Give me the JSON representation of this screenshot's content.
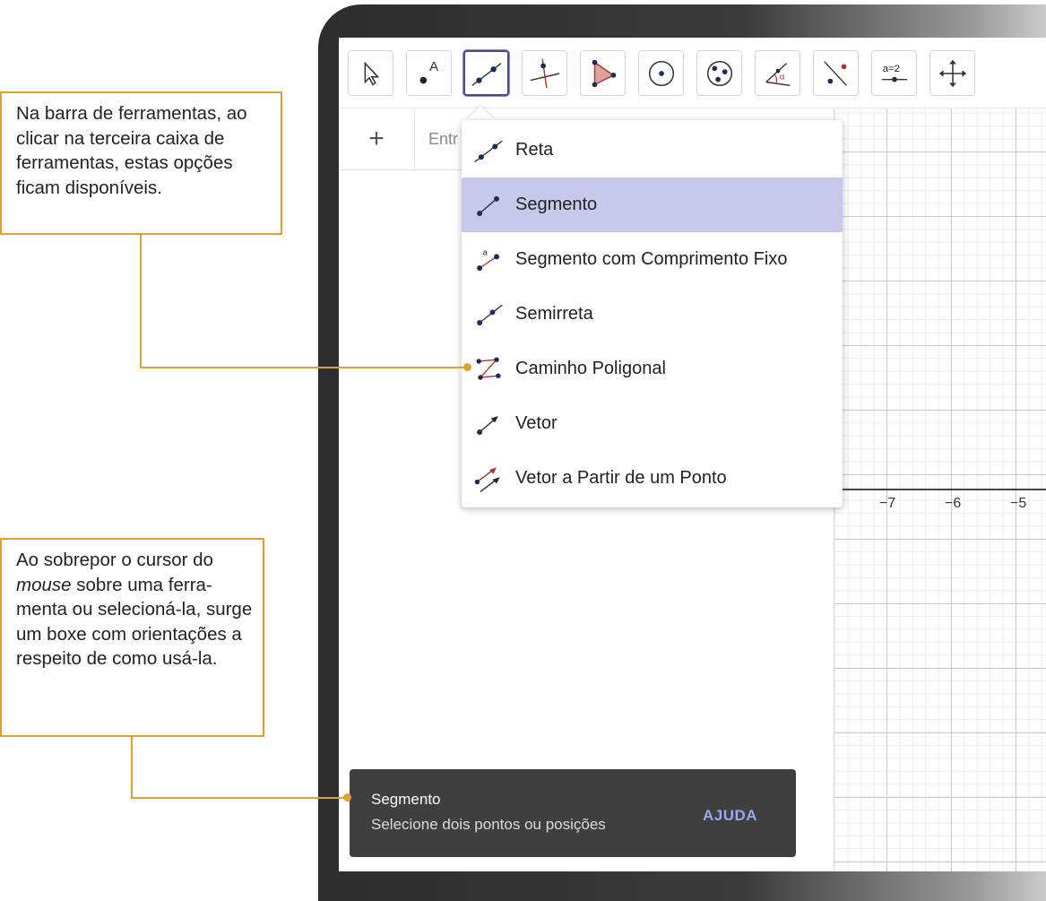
{
  "toolbar": {
    "tools": [
      {
        "name": "move-tool-icon"
      },
      {
        "name": "point-tool-icon"
      },
      {
        "name": "line-tool-icon"
      },
      {
        "name": "perpendicular-tool-icon"
      },
      {
        "name": "polygon-tool-icon"
      },
      {
        "name": "circle-tool-icon"
      },
      {
        "name": "conic-tool-icon"
      },
      {
        "name": "angle-tool-icon"
      },
      {
        "name": "reflect-tool-icon"
      },
      {
        "name": "slider-tool-icon",
        "label": "a=2"
      },
      {
        "name": "move-graphics-tool-icon"
      }
    ]
  },
  "algebra": {
    "add_symbol": "+",
    "input_placeholder": "Entr"
  },
  "menu": {
    "items": [
      {
        "label": "Reta",
        "icon": "line-icon"
      },
      {
        "label": "Segmento",
        "icon": "segment-icon",
        "selected": true
      },
      {
        "label": "Segmento com Comprimento Fixo",
        "icon": "segment-fixed-length-icon"
      },
      {
        "label": "Semirreta",
        "icon": "ray-icon"
      },
      {
        "label": "Caminho Poligonal",
        "icon": "polyline-icon"
      },
      {
        "label": "Vetor",
        "icon": "vector-icon"
      },
      {
        "label": "Vetor a Partir de um Ponto",
        "icon": "vector-from-point-icon"
      }
    ]
  },
  "graphics": {
    "x_ticks": [
      "−7",
      "−6",
      "−5"
    ]
  },
  "tooltip": {
    "title": "Segmento",
    "description": "Selecione dois pontos ou posições",
    "help_label": "AJUDA"
  },
  "annotations": {
    "callout1": "Na barra de ferramentas, ao clicar na terceira caixa de ferramentas, estas opções ficam disponíveis.",
    "callout2_part1": "Ao sobrepor o cursor do ",
    "callout2_italic": "mouse",
    "callout2_part2": " sobre uma ferra-menta ou selecioná-la, surge um boxe com orientações a respeito de como usá-la."
  },
  "colors": {
    "accent": "#e0a030",
    "selected_item": "#c8c8ec",
    "tooltip_bg": "#3f3f3f",
    "help_link": "#9ba6ee"
  }
}
